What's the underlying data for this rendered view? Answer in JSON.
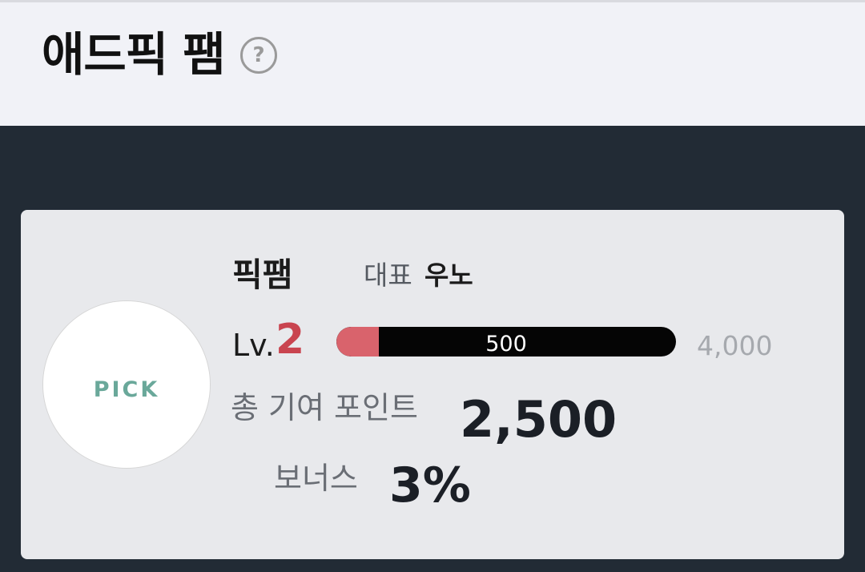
{
  "header": {
    "title": "애드픽 팸",
    "help_icon": "question-circle-icon",
    "help_glyph": "?"
  },
  "fan_card": {
    "avatar_text": "PICK",
    "name": "픽팸",
    "representative_label": "대표",
    "representative_name": "우노",
    "level_prefix": "Lv.",
    "level": "2",
    "progress": {
      "current_label": "500",
      "max_label": "4,000",
      "fraction": 0.125
    },
    "total_points_label": "총 기여 포인트",
    "total_points": "2,500",
    "bonus_label": "보너스",
    "bonus_value": "3%"
  },
  "colors": {
    "header_bg": "#f1f2f7",
    "page_bg": "#222b35",
    "card_bg": "#e8e9ec",
    "level_accent": "#c9444f",
    "progress_fill": "#d9636c",
    "progress_track": "#050505",
    "logo_teal": "#6aa89a"
  }
}
